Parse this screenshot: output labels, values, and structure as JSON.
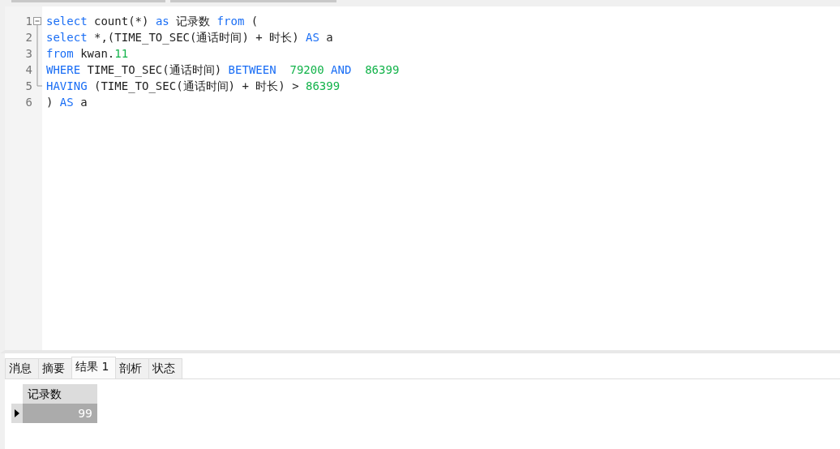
{
  "editor": {
    "lines": [
      {
        "number": "1",
        "kind": "fold_start",
        "tokens": [
          {
            "kind": "kw",
            "text": "select"
          },
          {
            "kind": "plain",
            "text": " count(*) "
          },
          {
            "kind": "kw",
            "text": "as"
          },
          {
            "kind": "plain",
            "text": " 记录数 "
          },
          {
            "kind": "kw",
            "text": "from"
          },
          {
            "kind": "plain",
            "text": " ("
          }
        ]
      },
      {
        "number": "2",
        "kind": "fold_mid",
        "tokens": [
          {
            "kind": "kw",
            "text": "select"
          },
          {
            "kind": "plain",
            "text": " *,(TIME_TO_SEC(通话时间) + 时长) "
          },
          {
            "kind": "kw",
            "text": "AS"
          },
          {
            "kind": "plain",
            "text": " a"
          }
        ]
      },
      {
        "number": "3",
        "kind": "fold_mid",
        "tokens": [
          {
            "kind": "kw",
            "text": "from"
          },
          {
            "kind": "plain",
            "text": " kwan."
          },
          {
            "kind": "num",
            "text": "11"
          }
        ]
      },
      {
        "number": "4",
        "kind": "fold_mid",
        "tokens": [
          {
            "kind": "kw",
            "text": "WHERE"
          },
          {
            "kind": "plain",
            "text": " TIME_TO_SEC(通话时间) "
          },
          {
            "kind": "kw",
            "text": "BETWEEN  "
          },
          {
            "kind": "num",
            "text": "79200 "
          },
          {
            "kind": "kw",
            "text": "AND  "
          },
          {
            "kind": "num",
            "text": "86399"
          }
        ]
      },
      {
        "number": "5",
        "kind": "fold_end",
        "tokens": [
          {
            "kind": "kw",
            "text": "HAVING"
          },
          {
            "kind": "plain",
            "text": " (TIME_TO_SEC(通话时间) + 时长) > "
          },
          {
            "kind": "num",
            "text": "86399"
          }
        ]
      },
      {
        "number": "6",
        "kind": "plain",
        "tokens": [
          {
            "kind": "plain",
            "text": ") "
          },
          {
            "kind": "kw",
            "text": "AS"
          },
          {
            "kind": "plain",
            "text": " a"
          }
        ]
      }
    ]
  },
  "result_tabs": [
    {
      "label": "消息",
      "selected": false
    },
    {
      "label": "摘要",
      "selected": false
    },
    {
      "label": "结果 1",
      "selected": true
    },
    {
      "label": "剖析",
      "selected": false
    },
    {
      "label": "状态",
      "selected": false
    }
  ],
  "grid": {
    "columns": [
      "记录数"
    ],
    "rows": [
      {
        "selected": true,
        "cells": [
          "99"
        ]
      }
    ]
  }
}
